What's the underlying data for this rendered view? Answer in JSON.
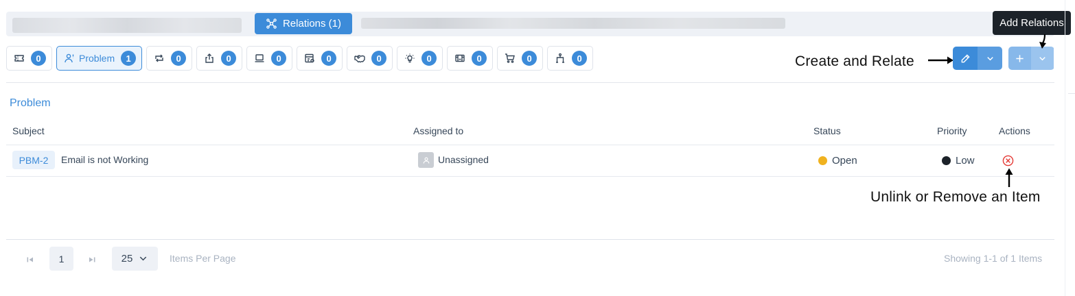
{
  "header": {
    "relations_tab_label": "Relations (1)"
  },
  "categories": [
    {
      "icon": "ticket-icon",
      "label": "",
      "count": "0",
      "active": false
    },
    {
      "icon": "user-problem-icon",
      "label": "Problem",
      "count": "1",
      "active": true
    },
    {
      "icon": "change-icon",
      "label": "",
      "count": "0",
      "active": false
    },
    {
      "icon": "release-icon",
      "label": "",
      "count": "0",
      "active": false
    },
    {
      "icon": "laptop-icon",
      "label": "",
      "count": "0",
      "active": false
    },
    {
      "icon": "project-icon",
      "label": "",
      "count": "0",
      "active": false
    },
    {
      "icon": "handshake-icon",
      "label": "",
      "count": "0",
      "active": false
    },
    {
      "icon": "lightbulb-icon",
      "label": "",
      "count": "0",
      "active": false
    },
    {
      "icon": "knowledge-icon",
      "label": "",
      "count": "0",
      "active": false
    },
    {
      "icon": "cart-icon",
      "label": "",
      "count": "0",
      "active": false
    },
    {
      "icon": "hierarchy-icon",
      "label": "",
      "count": "0",
      "active": false
    }
  ],
  "annotations": {
    "create_and_relate": "Create and Relate",
    "add_relations": "Add Relations",
    "unlink_remove": "Unlink or Remove an Item"
  },
  "section": {
    "title": "Problem"
  },
  "table": {
    "headers": {
      "subject": "Subject",
      "assigned_to": "Assigned to",
      "status": "Status",
      "priority": "Priority",
      "actions": "Actions"
    },
    "rows": [
      {
        "id": "PBM-2",
        "subject": "Email is not Working",
        "assignee": "Unassigned",
        "status": "Open",
        "status_color": "#f0b21f",
        "priority": "Low",
        "priority_color": "#1c2229"
      }
    ]
  },
  "pagination": {
    "current_page": "1",
    "per_page": "25",
    "per_page_label": "Items Per Page",
    "showing": "Showing 1-1 of 1 Items"
  },
  "colors": {
    "accent": "#3c8bd9",
    "remove": "#e53935"
  }
}
